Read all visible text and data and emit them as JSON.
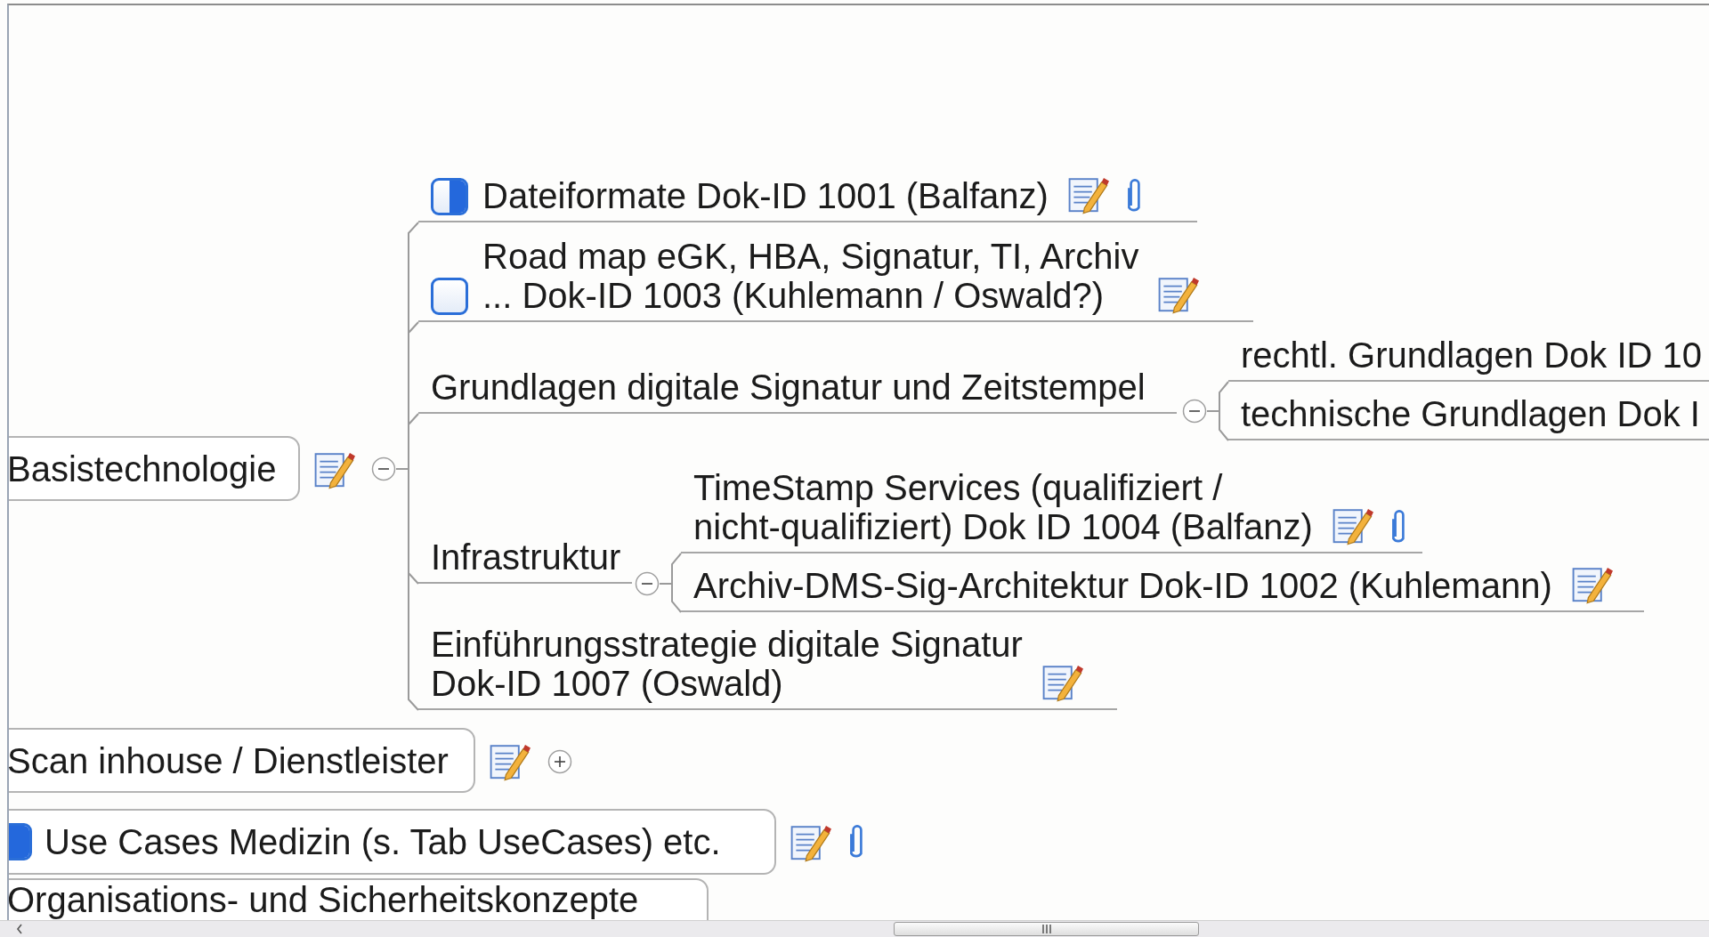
{
  "map": {
    "topics": [
      {
        "text": "Basistechnologie",
        "note": true,
        "expanded": true,
        "children": [
          {
            "text": "Dateiformate Dok-ID 1001 (Balfanz)",
            "checkbox": {
              "level": 0.5
            },
            "note": true,
            "attachment": true
          },
          {
            "text": "Road map eGK, HBA, Signatur, TI, Archiv\n... Dok-ID 1003 (Kuhlemann / Oswald?)",
            "checkbox": {
              "level": 0
            },
            "note": true
          },
          {
            "text": "Grundlagen digitale Signatur und Zeitstempel",
            "expanded": true,
            "children": [
              {
                "text": "rechtl. Grundlagen Dok ID 10"
              },
              {
                "text": "technische Grundlagen Dok I"
              }
            ]
          },
          {
            "text": "Infrastruktur",
            "expanded": true,
            "children": [
              {
                "text": "TimeStamp Services (qualifiziert /\nnicht-qualifiziert) Dok ID 1004 (Balfanz)",
                "note": true,
                "attachment": true
              },
              {
                "text": "Archiv-DMS-Sig-Architektur Dok-ID 1002 (Kuhlemann)",
                "note": true
              }
            ]
          },
          {
            "text": "Einführungsstrategie digitale Signatur\nDok-ID 1007 (Oswald)",
            "note": true
          }
        ]
      },
      {
        "text": "Scan inhouse / Dienstleister",
        "note": true,
        "expanded": false
      },
      {
        "text": "Use Cases Medizin (s. Tab UseCases) etc.",
        "checkbox": {
          "level": 0.75
        },
        "note": true,
        "attachment": true
      },
      {
        "text": "Organisations- und Sicherheitskonzepte"
      }
    ]
  }
}
